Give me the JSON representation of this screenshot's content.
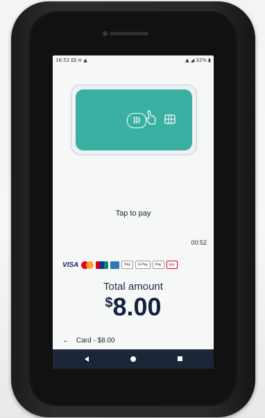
{
  "status_bar": {
    "time": "16:52",
    "left_icons": "🖾 ⊖ ▲",
    "right_text": "32%"
  },
  "card": {
    "contactless_symbol": ")))",
    "icons": [
      "contactless-icon",
      "tap-hand-icon",
      "chip-icon"
    ],
    "color": "#3ab0a3"
  },
  "prompt": "Tap to pay",
  "timer": "00:52",
  "payment_logos": {
    "visa": "VISA",
    "apple_pay": "Pay",
    "google_pay": "G Pay",
    "samsung_pay": "Pay",
    "huawei_pay": "pay"
  },
  "total_label": "Total amount",
  "amount": {
    "currency": "$",
    "value": "8.00"
  },
  "back_row": {
    "label": "Card - $8.00"
  },
  "colors": {
    "navbar": "#1b2638",
    "text_dark": "#13233f"
  }
}
